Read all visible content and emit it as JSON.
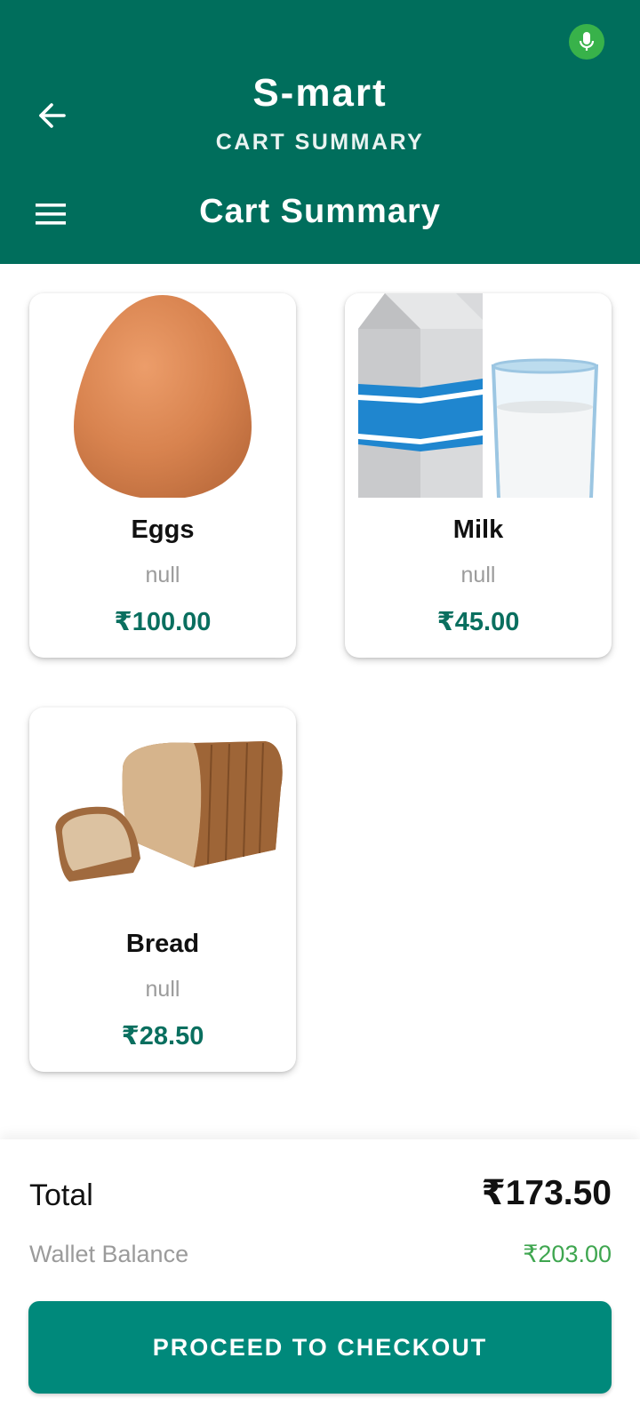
{
  "header": {
    "title": "S-mart",
    "subtitle": "CART SUMMARY",
    "toolbar_title": "Cart Summary",
    "color": "#006e5c"
  },
  "icons": {
    "mic": "mic-icon",
    "back": "arrow-left-icon",
    "menu": "hamburger-menu-icon"
  },
  "cart": {
    "items": [
      {
        "name": "Eggs",
        "description": "null",
        "price": "₹100.00",
        "image": "egg-image"
      },
      {
        "name": "Milk",
        "description": "null",
        "price": "₹45.00",
        "image": "milk-carton-glass-image"
      },
      {
        "name": "Bread",
        "description": "null",
        "price": "₹28.50",
        "image": "bread-loaf-image"
      }
    ]
  },
  "summary": {
    "total_label": "Total",
    "total_value": "₹173.50",
    "wallet_label": "Wallet Balance",
    "wallet_value": "₹203.00",
    "checkout_label": "PROCEED TO CHECKOUT"
  },
  "colors": {
    "accent": "#00897b",
    "price": "#0a6f5f",
    "wallet": "#3fa650"
  }
}
